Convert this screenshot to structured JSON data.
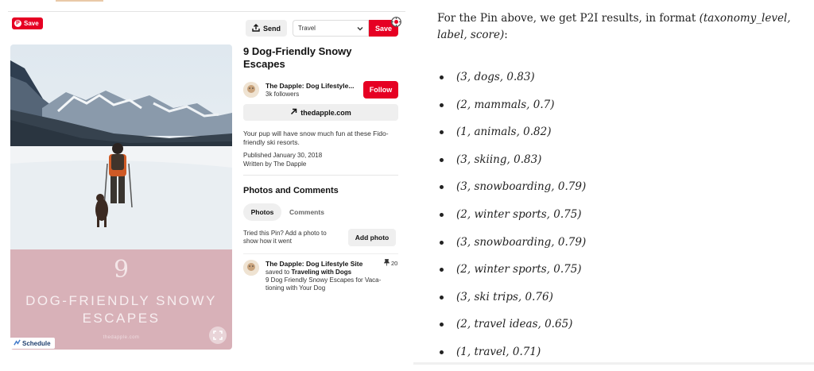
{
  "pin_card": {
    "save_pill_label": "Save",
    "send_label": "Send",
    "board_selected": "Travel",
    "save_button_label": "Save",
    "image": {
      "number": "9",
      "title_line1": "DOG-FRIENDLY SNOWY",
      "title_line2": "ESCAPES",
      "url": "thedapple.com",
      "schedule_label": "Schedule"
    },
    "title": "9 Dog-Friendly Snowy Escapes",
    "creator": {
      "name": "The Dapple: Dog Lifestyle...",
      "followers": "3k followers",
      "follow_label": "Follow"
    },
    "link_label": "thedapple.com",
    "description": "Your pup will have snow much fun at these Fido-friendly ski resorts.",
    "published": "Published January 30, 2018",
    "written_by": "Written by The Dapple",
    "section_title": "Photos and Comments",
    "tabs": [
      "Photos",
      "Comments"
    ],
    "tried_text": "Tried this Pin? Add a photo to show how it went",
    "add_photo_label": "Add photo",
    "activity": {
      "saver": "The Dapple: Dog Lifestyle Site",
      "saved_to_prefix": "saved to",
      "board": "Traveling with Dogs",
      "pin_count": "20",
      "description": "9 Dog Friendly Snowy Escapes for Vaca-tioning with Your Dog"
    }
  },
  "article": {
    "intro_prefix": "For the Pin above, we get P2I results, in format ",
    "intro_format": "(taxonomy_level, label, score)",
    "intro_suffix": ":",
    "results": [
      "(3, dogs, 0.83)",
      "(2, mammals, 0.7)",
      "(1, animals, 0.82)",
      "(3, skiing, 0.83)",
      "(3, snowboarding, 0.79)",
      "(2, winter sports, 0.75)",
      "(3, snowboarding, 0.79)",
      "(2, winter sports, 0.75)",
      "(3, ski trips, 0.76)",
      "(2, travel ideas, 0.65)",
      "(1, travel, 0.71)"
    ]
  },
  "colors": {
    "pinterest_red": "#e60023",
    "pink_panel": "#d8b1b8",
    "button_gray": "#efefef"
  }
}
